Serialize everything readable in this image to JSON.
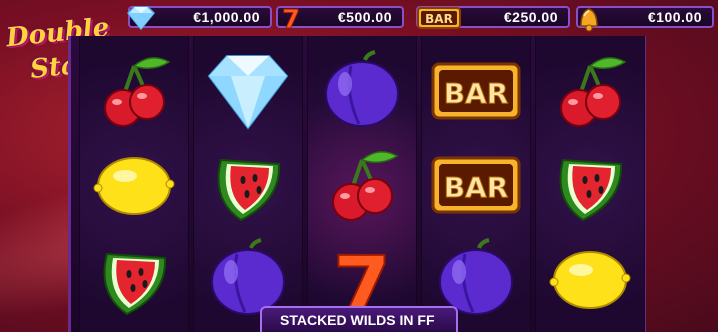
{
  "game": {
    "logo_line1": "Double",
    "logo_line2": "Stacks"
  },
  "paytable": [
    {
      "symbol": "diamond",
      "value": "€1,000.00"
    },
    {
      "symbol": "seven",
      "value": "€500.00"
    },
    {
      "symbol": "bar",
      "value": "€250.00"
    },
    {
      "symbol": "bell",
      "value": "€100.00"
    }
  ],
  "reels": [
    [
      "cherry",
      "lemon",
      "watermelon"
    ],
    [
      "diamond",
      "watermelon",
      "plum"
    ],
    [
      "plum",
      "cherry",
      "seven"
    ],
    [
      "bar",
      "bar",
      "plum"
    ],
    [
      "cherry",
      "watermelon",
      "lemon"
    ]
  ],
  "bar_label": "BAR",
  "seven_label": "7",
  "banner": {
    "text": "STACKED WILDS IN FF"
  },
  "colors": {
    "gold": "#ffd33b",
    "frame_purple": "#8a4ec9",
    "background_red": "#b0262f"
  }
}
